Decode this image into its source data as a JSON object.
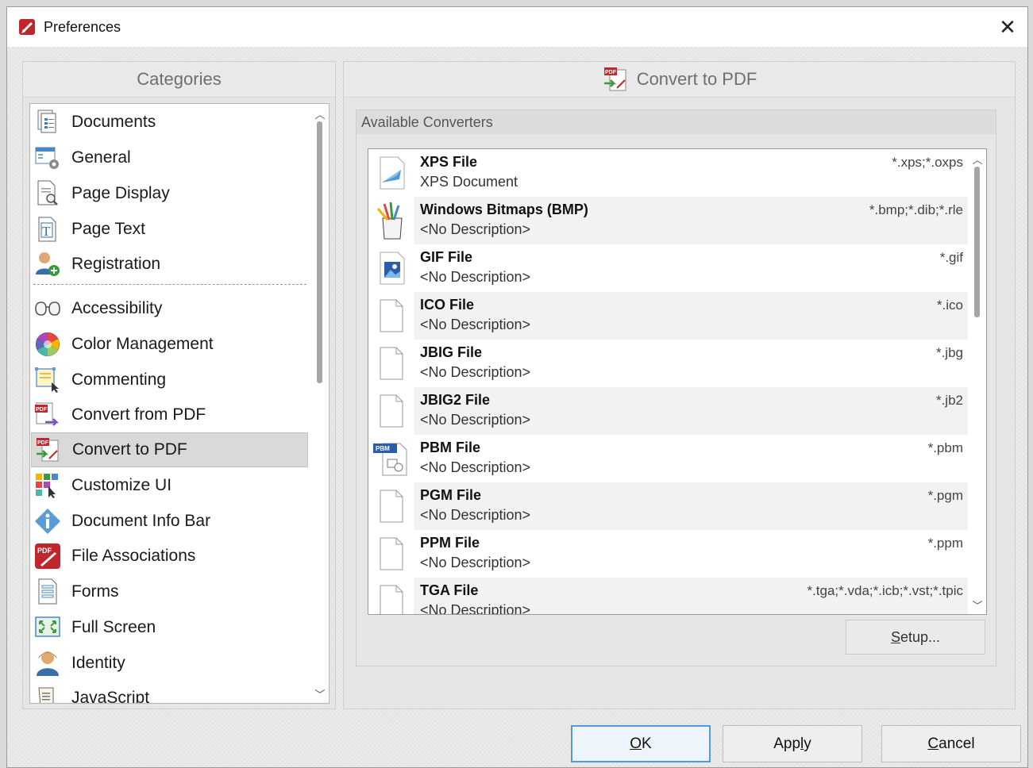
{
  "window": {
    "title": "Preferences",
    "close_glyph": "✕"
  },
  "categories": {
    "header": "Categories",
    "items": [
      {
        "label": "Documents",
        "icon": "documents-icon"
      },
      {
        "label": "General",
        "icon": "general-icon"
      },
      {
        "label": "Page Display",
        "icon": "page-display-icon"
      },
      {
        "label": "Page Text",
        "icon": "page-text-icon"
      },
      {
        "label": "Registration",
        "icon": "registration-icon"
      },
      {
        "label": "Accessibility",
        "icon": "accessibility-icon"
      },
      {
        "label": "Color Management",
        "icon": "color-management-icon"
      },
      {
        "label": "Commenting",
        "icon": "commenting-icon"
      },
      {
        "label": "Convert from PDF",
        "icon": "convert-from-pdf-icon"
      },
      {
        "label": "Convert to PDF",
        "icon": "convert-to-pdf-icon",
        "selected": true
      },
      {
        "label": "Customize UI",
        "icon": "customize-ui-icon"
      },
      {
        "label": "Document Info Bar",
        "icon": "info-icon"
      },
      {
        "label": "File Associations",
        "icon": "file-associations-icon"
      },
      {
        "label": "Forms",
        "icon": "forms-icon"
      },
      {
        "label": "Full Screen",
        "icon": "full-screen-icon"
      },
      {
        "label": "Identity",
        "icon": "identity-icon"
      },
      {
        "label": "JavaScript",
        "icon": "javascript-icon"
      }
    ]
  },
  "convert_panel": {
    "header": "Convert to PDF",
    "group_label": "Available Converters",
    "converters": [
      {
        "name": "XPS File",
        "description": "XPS Document",
        "extensions": "*.xps;*.oxps",
        "icon": "xps-icon"
      },
      {
        "name": "Windows Bitmaps (BMP)",
        "description": "<No Description>",
        "extensions": "*.bmp;*.dib;*.rle",
        "icon": "bmp-icon"
      },
      {
        "name": "GIF File",
        "description": "<No Description>",
        "extensions": "*.gif",
        "icon": "gif-icon"
      },
      {
        "name": "ICO File",
        "description": "<No Description>",
        "extensions": "*.ico",
        "icon": "blank-page-icon"
      },
      {
        "name": "JBIG File",
        "description": "<No Description>",
        "extensions": "*.jbg",
        "icon": "blank-page-icon"
      },
      {
        "name": "JBIG2 File",
        "description": "<No Description>",
        "extensions": "*.jb2",
        "icon": "blank-page-icon"
      },
      {
        "name": "PBM File",
        "description": "<No Description>",
        "extensions": "*.pbm",
        "icon": "pbm-icon"
      },
      {
        "name": "PGM File",
        "description": "<No Description>",
        "extensions": "*.pgm",
        "icon": "blank-page-icon"
      },
      {
        "name": "PPM File",
        "description": "<No Description>",
        "extensions": "*.ppm",
        "icon": "blank-page-icon"
      },
      {
        "name": "TGA File",
        "description": "<No Description>",
        "extensions": "*.tga;*.vda;*.icb;*.vst;*.tpic",
        "icon": "blank-page-icon"
      }
    ],
    "setup_label_prefix": "",
    "setup_label_underlined": "S",
    "setup_label_rest": "etup..."
  },
  "buttons": {
    "ok_underlined": "O",
    "ok_rest": "K",
    "apply_prefix": "App",
    "apply_underlined": "l",
    "apply_rest": "y",
    "cancel_underlined": "C",
    "cancel_rest": "ancel"
  },
  "colors": {
    "accent": "#4d9be0",
    "selected_row": "#d9d9d9",
    "brand_red": "#c0272d"
  }
}
